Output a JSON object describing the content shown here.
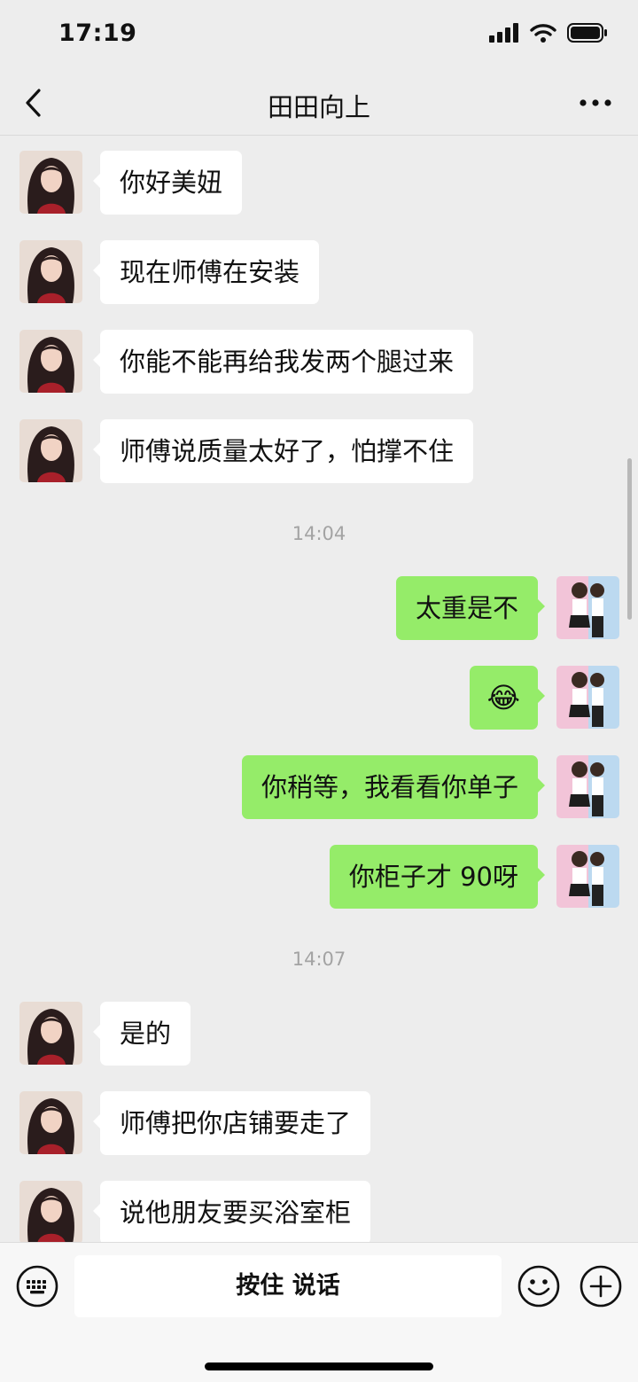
{
  "status_bar": {
    "time": "17:19"
  },
  "header": {
    "title": "田田向上"
  },
  "messages": [
    {
      "side": "left",
      "text": "你好美妞"
    },
    {
      "side": "left",
      "text": "现在师傅在安装"
    },
    {
      "side": "left",
      "text": "你能不能再给我发两个腿过来"
    },
    {
      "side": "left",
      "text": "师傅说质量太好了，怕撑不住"
    },
    {
      "side": "right",
      "text": "太重是不"
    },
    {
      "side": "right",
      "emoji": "😂"
    },
    {
      "side": "right",
      "text": "你稍等，我看看你单子"
    },
    {
      "side": "right",
      "text": "你柜子才 90呀"
    },
    {
      "side": "left",
      "text": "是的"
    },
    {
      "side": "left",
      "text": "师傅把你店铺要走了"
    },
    {
      "side": "left",
      "text": "说他朋友要买浴室柜"
    }
  ],
  "timestamps": [
    "14:04",
    "14:07"
  ],
  "input_bar": {
    "voice_label": "按住 说话"
  },
  "icons": {
    "back": "chevron-left-icon",
    "more": "more-dots-icon",
    "keyboard": "keyboard-icon",
    "emoji": "emoji-icon",
    "plus": "plus-icon"
  },
  "colors": {
    "background": "#ededed",
    "sent_bubble": "#95ec69",
    "received_bubble": "#ffffff"
  }
}
